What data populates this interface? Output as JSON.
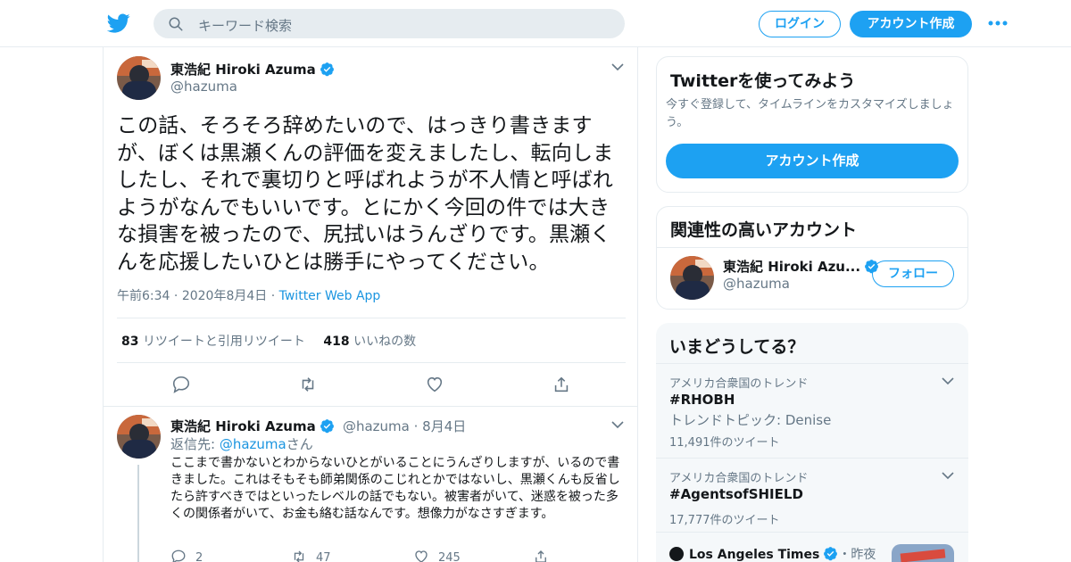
{
  "header": {
    "search_placeholder": "キーワード検索",
    "login_label": "ログイン",
    "signup_label": "アカウント作成"
  },
  "tweet": {
    "display_name": "東浩紀 Hiroki Azuma",
    "handle": "@hazuma",
    "text": "この話、そろそろ辞めたいので、はっきり書きますが、ぼくは黒瀬くんの評価を変えましたし、転向しましたし、それで裏切りと呼ばれようが不人情と呼ばれようがなんでもいいです。とにかく今回の件では大きな損害を被ったので、尻拭いはうんざりです。黒瀬くんを応援したいひとは勝手にやってください。",
    "time": "午前6:34",
    "date": "2020年8月4日",
    "via": "Twitter Web App",
    "retweet_count": "83",
    "retweet_label": "リツイートと引用リツイート",
    "like_count": "418",
    "like_label": "いいねの数"
  },
  "reply": {
    "display_name": "東浩紀 Hiroki Azuma",
    "handle": "@hazuma",
    "date": "8月4日",
    "reply_prefix": "返信先: ",
    "reply_to": "@hazuma",
    "reply_suffix": "さん",
    "text": "ここまで書かないとわからないひとがいることにうんざりしますが、いるので書きました。これはそもそも師弟関係のこじれとかではないし、黒瀬くんも反省したら許すべきではといったレベルの話でもない。被害者がいて、迷惑を被った多くの関係者がいて、お金も絡む話なんです。想像力がなさすぎます。",
    "reply_count": "2",
    "retweet_count": "47",
    "like_count": "245"
  },
  "signup_card": {
    "title": "Twitterを使ってみよう",
    "subtitle": "今すぐ登録して、タイムラインをカスタマイズしましょう。",
    "button": "アカウント作成"
  },
  "related_card": {
    "title": "関連性の高いアカウント",
    "display_name": "東浩紀 Hiroki Azu...",
    "handle": "@hazuma",
    "follow_label": "フォロー"
  },
  "trends_card": {
    "title": "いまどうしてる？",
    "items": [
      {
        "location": "アメリカ合衆国のトレンド",
        "name": "#RHOBH",
        "topic": "トレンドトピック: Denise",
        "count": "11,491件のツイート"
      },
      {
        "location": "アメリカ合衆国のトレンド",
        "name": "#AgentsofSHIELD",
        "count": "17,777件のツイート"
      }
    ],
    "news_source": "Los Angeles Times",
    "news_time": "・昨夜"
  },
  "colors": {
    "accent": "#1da1f2",
    "text": "#14171a",
    "muted": "#657786",
    "border": "#e6ecf0"
  }
}
